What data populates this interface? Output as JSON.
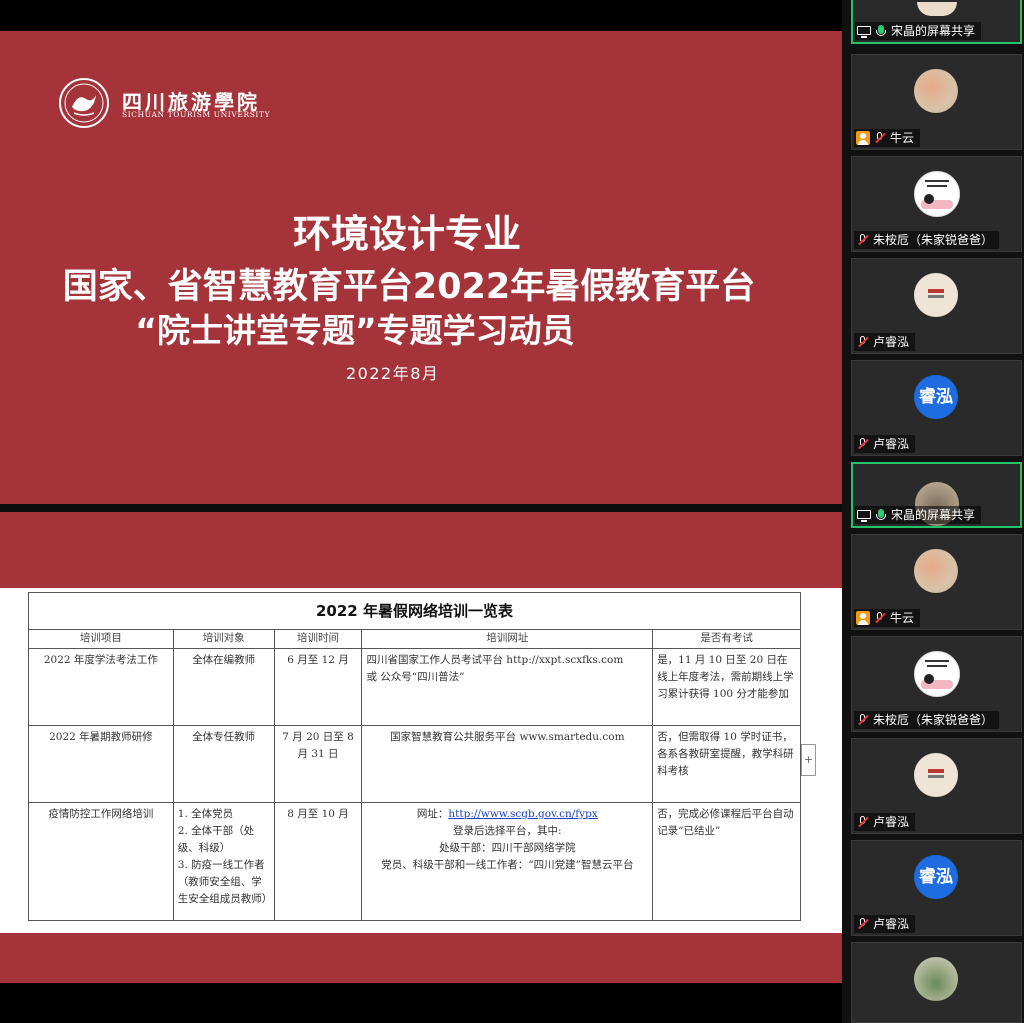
{
  "slide_title": {
    "school_cn": "四川旅游學院",
    "school_en": "SICHUAN TOURISM UNIVERSITY",
    "line1": "环境设计专业",
    "line2": "国家、省智慧教育平台2022年暑假教育平台",
    "line3": "“院士讲堂专题”专题学习动员",
    "date": "2022年8月"
  },
  "doc_table": {
    "caption": "2022 年暑假网络培训一览表",
    "headers": [
      "培训项目",
      "培训对象",
      "培训时间",
      "培训网址",
      "是否有考试"
    ],
    "rows": [
      {
        "project": "2022 年度学法考法工作",
        "target": "全体在编教师",
        "time": "6 月至 12 月",
        "url_line1": "四川省国家工作人员考试平台 http://xxpt.scxfks.com",
        "url_line2": "或 公众号“四川普法”",
        "exam": "是，11 月 10 日至 20 日在线上年度考法，需前期线上学习累计获得 100 分才能参加"
      },
      {
        "project": "2022 年暑期教师研修",
        "target": "全体专任教师",
        "time": "7 月 20 日至 8 月 31 日",
        "url_line1": "国家智慧教育公共服务平台 www.smartedu.com",
        "url_line2": "",
        "exam": "否，但需取得 10 学时证书，各系各教研室提醒，教学科研科考核"
      },
      {
        "project": "疫情防控工作网络培训",
        "target_items": [
          "1. 全体党员",
          "2. 全体干部（处级、科级）",
          "3. 防疫一线工作者（教师安全组、学生安全组成员教师）"
        ],
        "time": "8 月至 10 月",
        "url_prefix": "网址：",
        "url_link": "http://www.scgb.gov.cn/fypx",
        "url_line2": "登录后选择平台，其中:",
        "url_line3": "处级干部：四川干部网络学院",
        "url_line4": "党员、科级干部和一线工作者：“四川党建”智慧云平台",
        "exam": "否，完成必修课程后平台自动记录“已结业”"
      }
    ],
    "scroll_plus": "+"
  },
  "participants": [
    {
      "name": "宋晶的屏幕共享",
      "status": "screen",
      "active": true
    },
    {
      "name": "牛云",
      "status": "muted-host"
    },
    {
      "name": "朱桉卮（朱家锐爸爸）",
      "status": "muted"
    },
    {
      "name": "卢睿泓",
      "status": "muted"
    },
    {
      "name": "卢睿泓",
      "status": "muted",
      "avatar_text": "睿泓"
    },
    {
      "name": "宋晶的屏幕共享",
      "status": "screen",
      "active": true
    },
    {
      "name": "牛云",
      "status": "muted-host"
    },
    {
      "name": "朱桉卮（朱家锐爸爸）",
      "status": "muted"
    },
    {
      "name": "卢睿泓",
      "status": "muted"
    },
    {
      "name": "卢睿泓",
      "status": "muted",
      "avatar_text": "睿泓"
    },
    {
      "name": "",
      "status": "muted"
    }
  ],
  "colors": {
    "slide_red": "#a4343a",
    "active_border": "#25c26a",
    "avatar_blue": "#1d6de0"
  }
}
